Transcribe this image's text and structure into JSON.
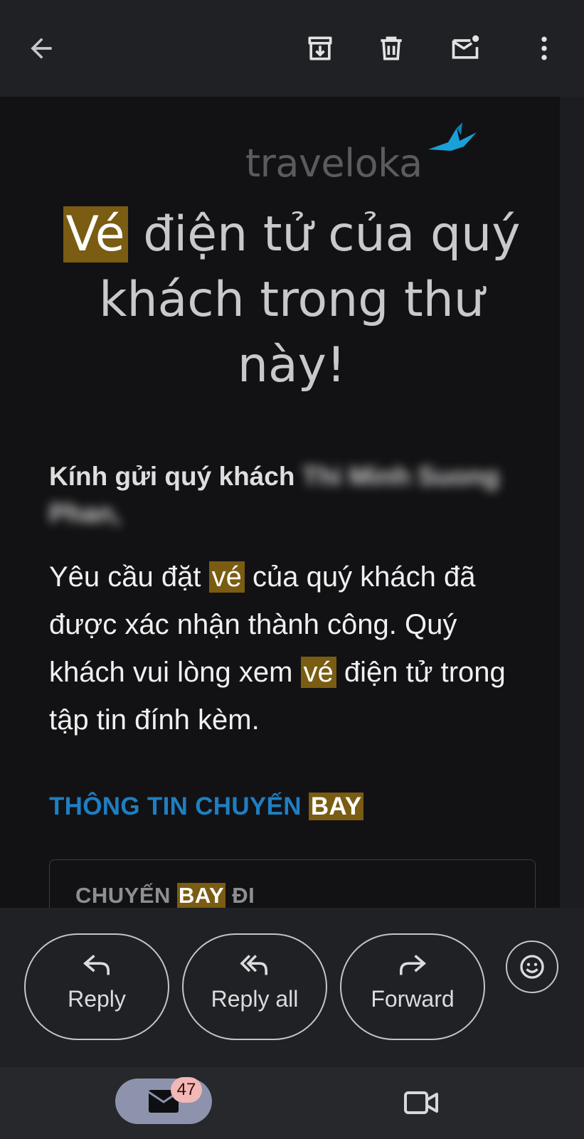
{
  "toolbar": {
    "back_icon": "arrow-left-icon",
    "archive_icon": "archive-icon",
    "delete_icon": "trash-icon",
    "mark_unread_icon": "mail-unread-icon",
    "more_icon": "more-vert-icon"
  },
  "email": {
    "logo_text": "traveloka",
    "headline": {
      "highlight": "Vé",
      "rest": " điện tử của quý khách trong thư này!"
    },
    "greeting_prefix": "Kính gửi quý khách ",
    "recipient_name": "Thi Minh Suong Phan,",
    "message": {
      "part1": "Yêu cầu đặt ",
      "hl1": "vé",
      "part2": " của quý khách đã được xác nhận thành công. Quý khách vui lòng xem ",
      "hl2": "vé",
      "part3": " điện tử trong tập tin đính kèm."
    },
    "section_title": {
      "prefix": "THÔNG TIN CHUYẾN ",
      "highlight": "BAY"
    },
    "card_title": {
      "prefix": "CHUYẾN ",
      "highlight": "BAY",
      "suffix": " ĐI"
    },
    "highlight_color": "#7a5c12",
    "accent_color": "#1e7fc3"
  },
  "actions": {
    "reply": "Reply",
    "reply_all": "Reply all",
    "forward": "Forward",
    "emoji_icon": "smiley-icon"
  },
  "bottom_nav": {
    "mail_badge": "47",
    "mail_icon": "mail-icon",
    "meet_icon": "video-camera-icon"
  }
}
